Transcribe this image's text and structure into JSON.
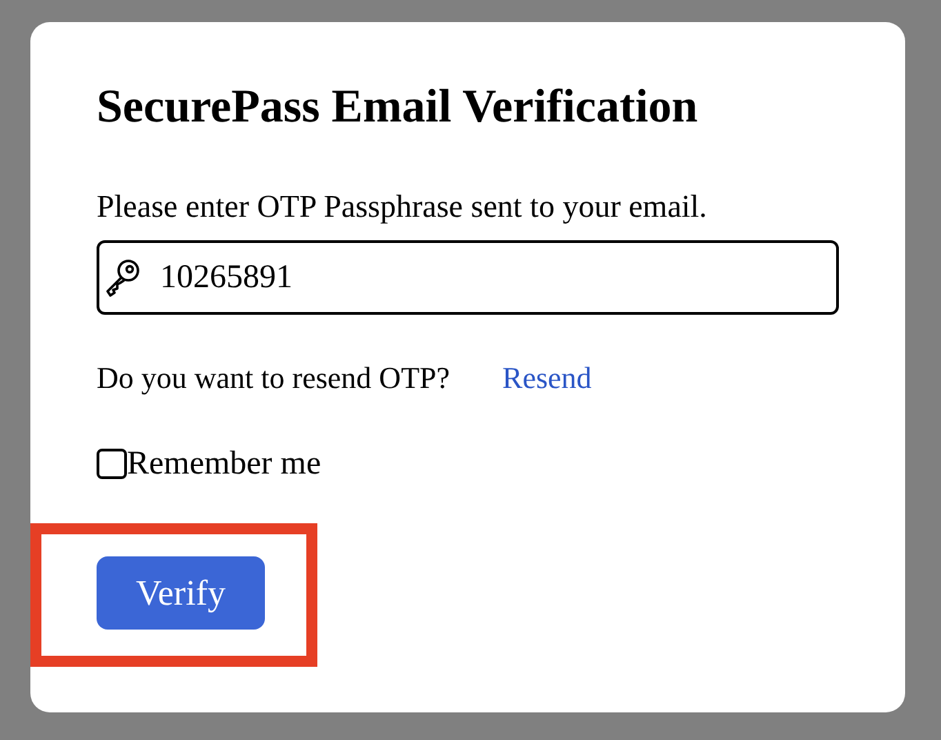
{
  "dialog": {
    "title": "SecurePass Email Verification",
    "prompt": "Please enter OTP Passphrase sent to your email.",
    "otp_field": {
      "value": "10265891"
    },
    "resend": {
      "question": "Do you want to resend OTP?",
      "link": "Resend"
    },
    "remember": {
      "label": "Remember me",
      "checked": false
    },
    "verify_button": {
      "label": "Verify",
      "highlighted": true
    }
  }
}
